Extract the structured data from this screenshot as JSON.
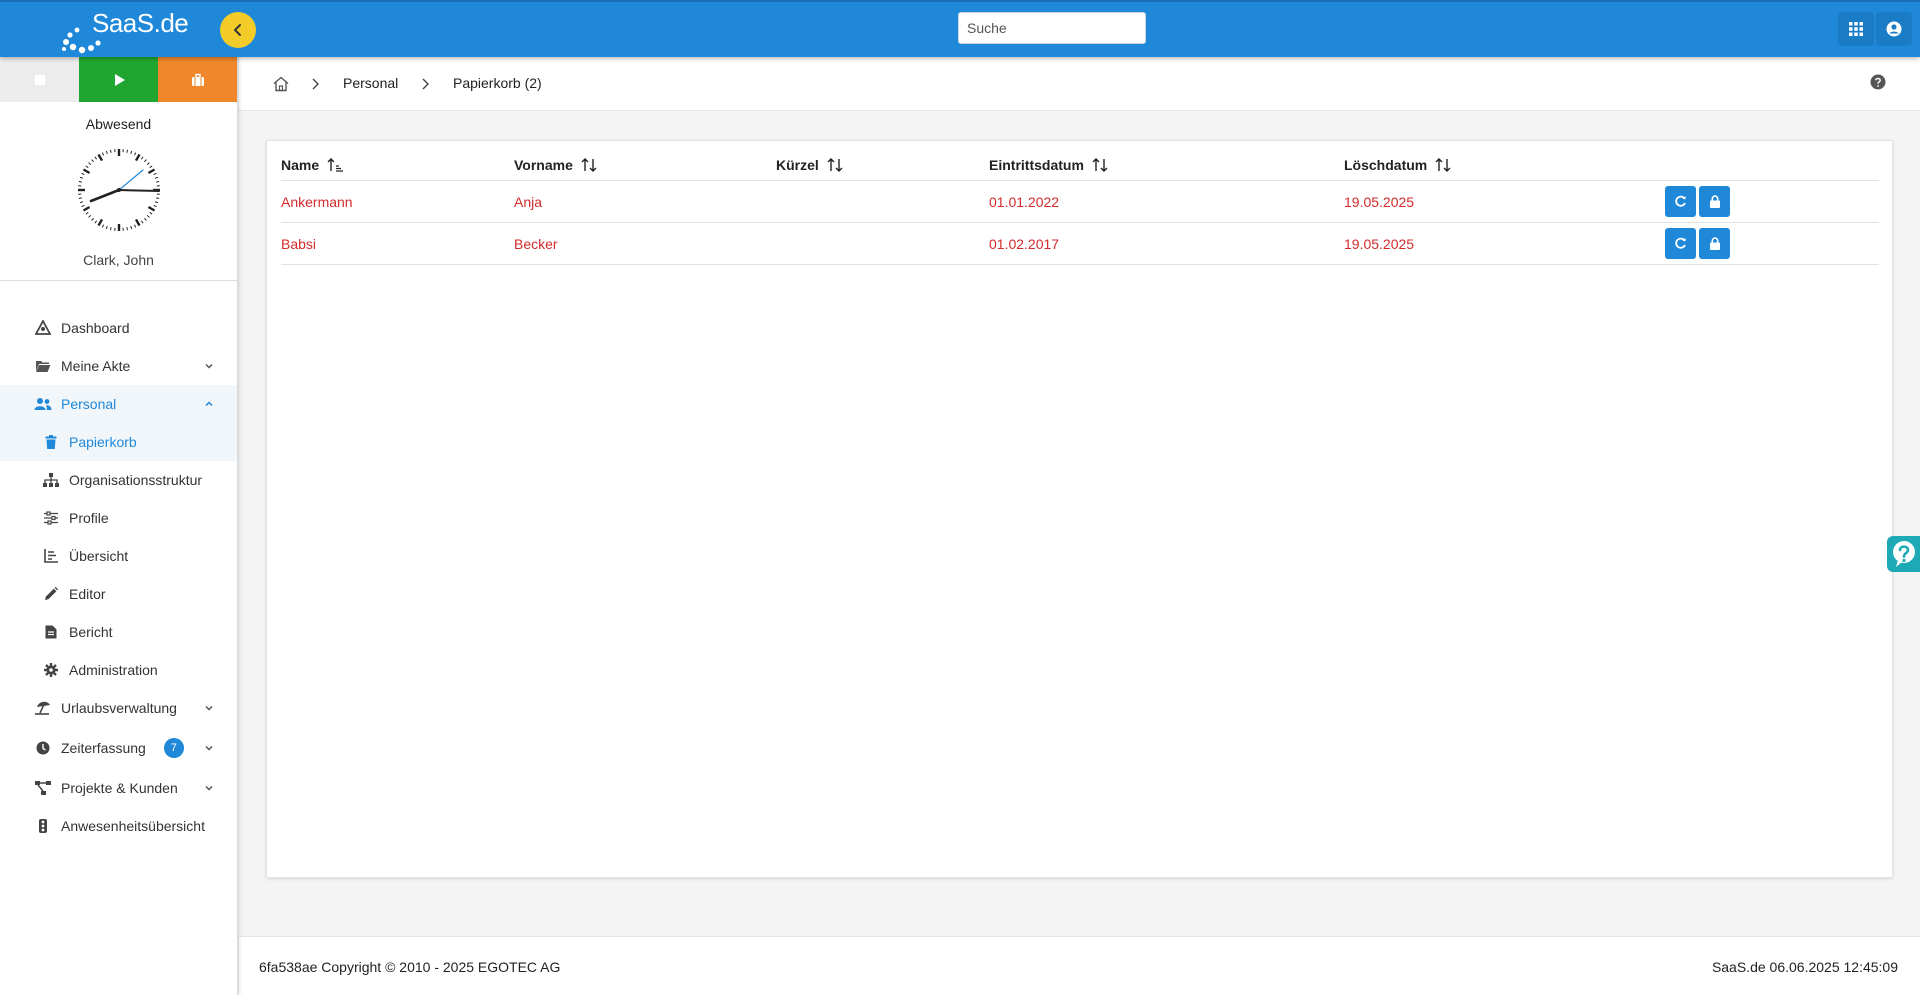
{
  "header": {
    "logo_text": "SaaS.de",
    "search": {
      "placeholder": "Suche",
      "value": ""
    },
    "icons": [
      "grid-icon",
      "user-circle-icon"
    ]
  },
  "sidebar": {
    "status_label": "Abwesend",
    "user_name": "Clark, John",
    "clock_time": "08:19",
    "items": [
      {
        "label": "Dashboard",
        "icon": "dashboard-icon"
      },
      {
        "label": "Meine Akte",
        "icon": "folder-open-icon",
        "expandable": true
      },
      {
        "label": "Personal",
        "icon": "users-icon",
        "expanded": true
      },
      {
        "label": "Papierkorb",
        "icon": "trash-icon",
        "sub": true,
        "active": true
      },
      {
        "label": "Organisationsstruktur",
        "icon": "sitemap-icon",
        "sub": true
      },
      {
        "label": "Profile",
        "icon": "sliders-icon",
        "sub": true
      },
      {
        "label": "Übersicht",
        "icon": "list-chart-icon",
        "sub": true
      },
      {
        "label": "Editor",
        "icon": "pencil-icon",
        "sub": true
      },
      {
        "label": "Bericht",
        "icon": "file-report-icon",
        "sub": true
      },
      {
        "label": "Administration",
        "icon": "gear-icon",
        "sub": true
      },
      {
        "label": "Urlaubsverwaltung",
        "icon": "umbrella-beach-icon",
        "expandable": true
      },
      {
        "label": "Zeiterfassung",
        "icon": "clock-icon",
        "expandable": true,
        "badge": "7"
      },
      {
        "label": "Projekte & Kunden",
        "icon": "project-diagram-icon",
        "expandable": true
      },
      {
        "label": "Anwesenheitsübersicht",
        "icon": "traffic-light-icon"
      }
    ]
  },
  "breadcrumb": {
    "items": [
      "Personal",
      "Papierkorb (2)"
    ]
  },
  "table": {
    "columns": [
      "Name",
      "Vorname",
      "Kürzel",
      "Eintrittsdatum",
      "Löschdatum"
    ],
    "rows": [
      {
        "name": "Ankermann",
        "vorname": "Anja",
        "kuerzel": "",
        "eintritt": "01.01.2022",
        "loesch": "19.05.2025"
      },
      {
        "name": "Babsi",
        "vorname": "Becker",
        "kuerzel": "",
        "eintritt": "01.02.2017",
        "loesch": "19.05.2025"
      }
    ]
  },
  "footer": {
    "left": "6fa538ae Copyright © 2010 - 2025 EGOTEC AG",
    "right": "SaaS.de  06.06.2025 12:45:09"
  },
  "colors": {
    "primary": "#1f88d9",
    "accent_yellow": "#f4cc29",
    "play_green": "#1fa630",
    "pause_orange": "#f0882b",
    "deleted_red": "#d32b2b",
    "help_teal": "#1ea9b7"
  }
}
